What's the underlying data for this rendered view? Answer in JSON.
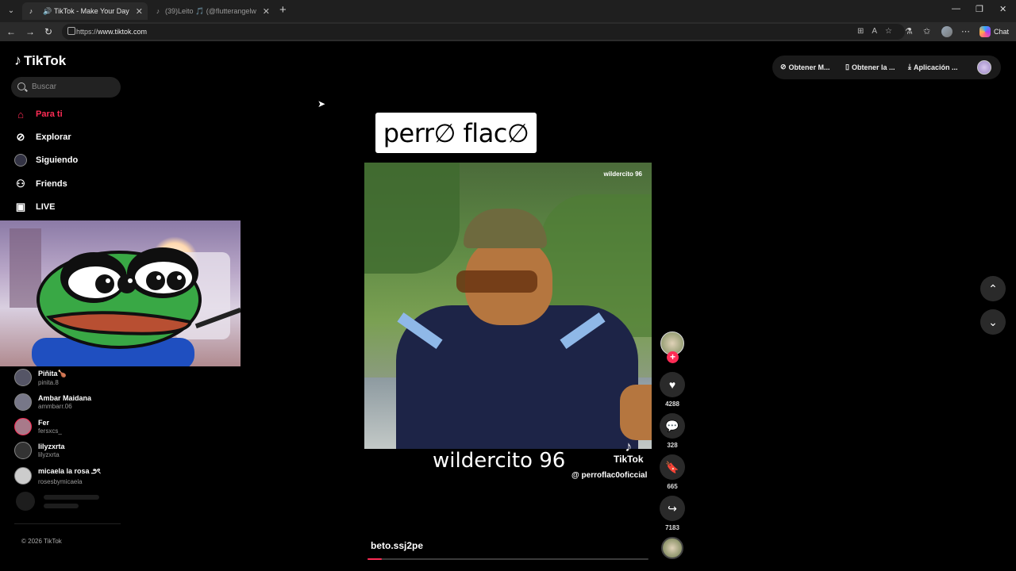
{
  "browser": {
    "tabs": [
      {
        "title": "TikTok - Make Your Day",
        "active": true
      },
      {
        "title": "(39)Leito 🎵 (@flutterangelw",
        "active": false
      }
    ],
    "url_prefix": "https://",
    "url_domain": "www.tiktok.com",
    "chat_label": "Chat"
  },
  "sidebar": {
    "logo": "TikTok",
    "search_placeholder": "Buscar",
    "nav": [
      {
        "label": "Para ti",
        "icon": "home-icon",
        "active": true
      },
      {
        "label": "Explorar",
        "icon": "compass-icon"
      },
      {
        "label": "Siguiendo",
        "icon": "following-avatar-icon"
      },
      {
        "label": "Friends",
        "icon": "friends-icon"
      },
      {
        "label": "LIVE",
        "icon": "live-icon"
      }
    ],
    "following": [
      {
        "name": "Piñita🍗",
        "handle": "pinita.8"
      },
      {
        "name": "Ambar Maidana",
        "handle": "ammbarr.06"
      },
      {
        "name": "Fer",
        "handle": "fersxcs_"
      },
      {
        "name": "lilyzxrta",
        "handle": "lilyzxrta"
      },
      {
        "name": "micaela la rosa ౨ৎ",
        "handle": "rosesbymicaela"
      }
    ],
    "copyright": "© 2026 TikTok"
  },
  "top_actions": [
    {
      "label": "Obtener M...",
      "icon": "coin-icon"
    },
    {
      "label": "Obtener la ...",
      "icon": "phone-icon"
    },
    {
      "label": "Aplicación ...",
      "icon": "download-icon"
    }
  ],
  "video": {
    "caption": "perr∅ flac∅",
    "watermark": "wildercito 96",
    "title": "wildercito 96",
    "brand": "TikTok",
    "credit": "@ perroflac0oficcial",
    "author": "beto.ssj2pe",
    "progress": 0.05
  },
  "actions": {
    "likes": "4288",
    "comments": "328",
    "saves": "665",
    "shares": "7183"
  },
  "colors": {
    "accent": "#fe2c55",
    "background": "#000000"
  }
}
